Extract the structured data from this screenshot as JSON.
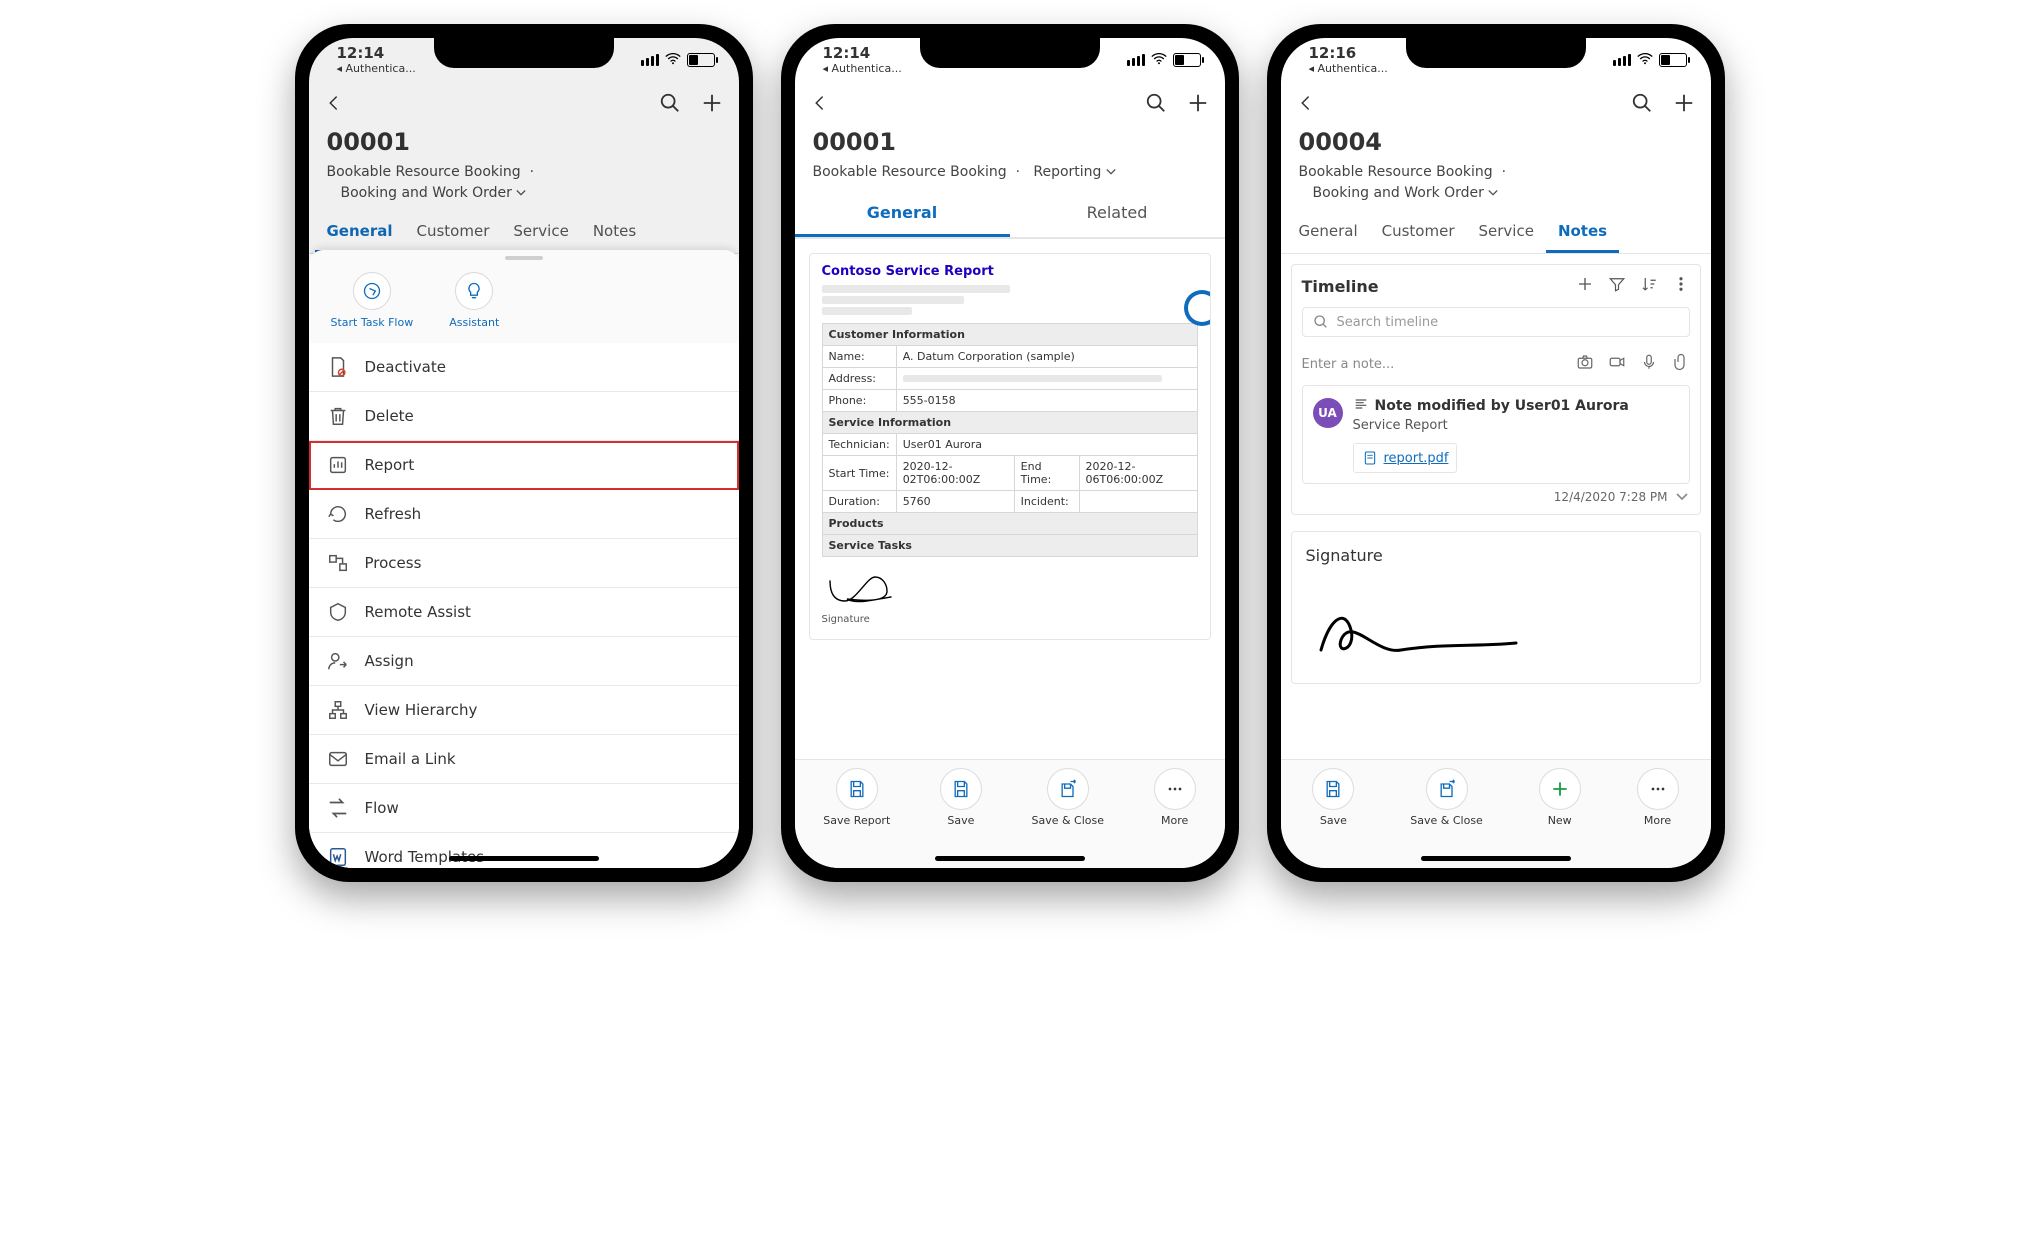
{
  "phone1": {
    "status": {
      "time": "12:14",
      "back_app": "◂ Authentica..."
    },
    "entity": {
      "number": "00001",
      "entity_type": "Bookable Resource Booking",
      "form": "Booking and Work Order"
    },
    "tabs": [
      "General",
      "Customer",
      "Service",
      "Notes"
    ],
    "active_tab": "General",
    "quick_actions": {
      "start_task_flow": "Start Task Flow",
      "assistant": "Assistant"
    },
    "menu": {
      "deactivate": "Deactivate",
      "delete": "Delete",
      "report": "Report",
      "refresh": "Refresh",
      "process": "Process",
      "remote_assist": "Remote Assist",
      "assign": "Assign",
      "view_hierarchy": "View Hierarchy",
      "email_link": "Email a Link",
      "flow": "Flow",
      "word_templates": "Word Templates"
    }
  },
  "phone2": {
    "status": {
      "time": "12:14",
      "back_app": "◂ Authentica..."
    },
    "entity": {
      "number": "00001",
      "entity_type": "Bookable Resource Booking",
      "form": "Reporting"
    },
    "tabs": {
      "general": "General",
      "related": "Related",
      "active": "General"
    },
    "report": {
      "title": "Contoso Service Report",
      "customer_section": "Customer Information",
      "name_label": "Name:",
      "name": "A. Datum Corporation (sample)",
      "address_label": "Address:",
      "phone_label": "Phone:",
      "phone": "555-0158",
      "service_section": "Service Information",
      "technician_label": "Technician:",
      "technician": "User01 Aurora",
      "start_label": "Start Time:",
      "start": "2020-12-02T06:00:00Z",
      "end_label": "End Time:",
      "end": "2020-12-06T06:00:00Z",
      "duration_label": "Duration:",
      "duration": "5760",
      "incident_label": "Incident:",
      "products_section": "Products",
      "tasks_section": "Service Tasks",
      "signature_label": "Signature"
    },
    "bottom": {
      "save_report": "Save Report",
      "save": "Save",
      "save_close": "Save & Close",
      "more": "More"
    }
  },
  "phone3": {
    "status": {
      "time": "12:16",
      "back_app": "◂ Authentica..."
    },
    "entity": {
      "number": "00004",
      "entity_type": "Bookable Resource Booking",
      "form": "Booking and Work Order"
    },
    "tabs": [
      "General",
      "Customer",
      "Service",
      "Notes"
    ],
    "active_tab": "Notes",
    "timeline": {
      "title": "Timeline",
      "search_placeholder": "Search timeline",
      "enter_note": "Enter a note...",
      "avatar": "UA",
      "note_title": "Note modified by User01 Aurora",
      "note_subtitle": "Service Report",
      "file": "report.pdf",
      "timestamp": "12/4/2020 7:28 PM"
    },
    "signature_label": "Signature",
    "bottom": {
      "save": "Save",
      "save_close": "Save & Close",
      "new": "New",
      "more": "More"
    }
  }
}
